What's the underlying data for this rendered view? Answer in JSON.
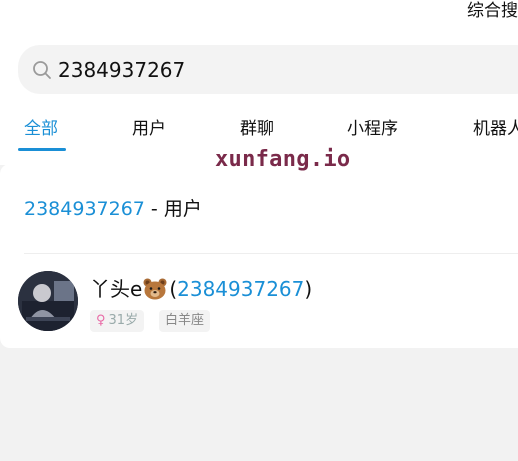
{
  "header": {
    "right_label": "综合搜"
  },
  "search": {
    "value": "2384937267",
    "icon": "search-icon"
  },
  "tabs": [
    {
      "label": "全部",
      "active": true
    },
    {
      "label": "用户",
      "active": false
    },
    {
      "label": "群聊",
      "active": false
    },
    {
      "label": "小程序",
      "active": false
    },
    {
      "label": "机器人",
      "active": false
    }
  ],
  "results": {
    "section_number": "2384937267",
    "section_suffix": " - 用户",
    "user": {
      "name": "丫头e",
      "name_emoji": "bear-face-icon",
      "uid_open": "(",
      "uid": "2384937267",
      "uid_close": ")",
      "gender_symbol": "♀",
      "age": "31岁",
      "zodiac": "白羊座"
    }
  },
  "watermark": "xunfang.io",
  "colors": {
    "accent": "#1a8fd6",
    "background": "#f2f2f2",
    "card": "#ffffff",
    "female": "#e86aa6",
    "watermark": "#7a2a4a"
  }
}
